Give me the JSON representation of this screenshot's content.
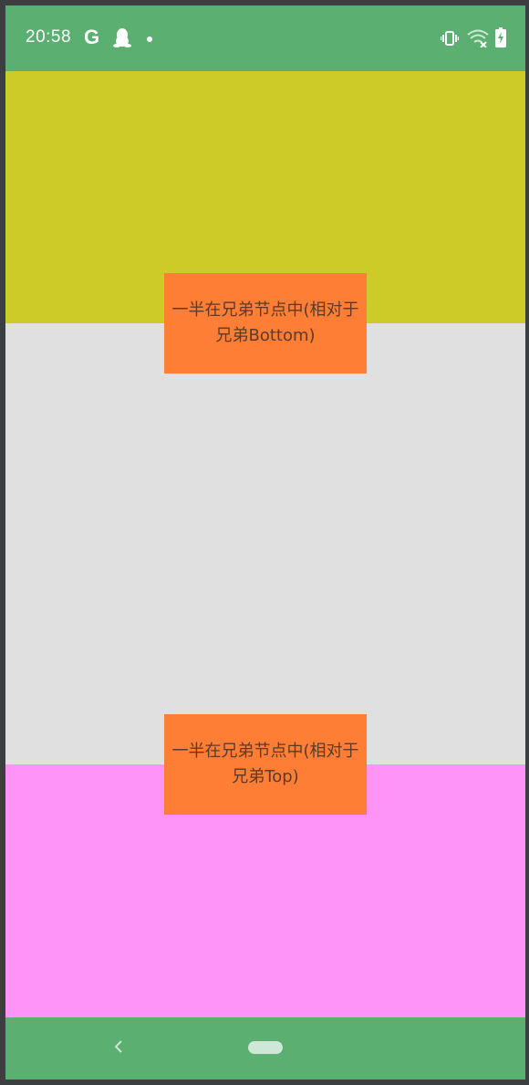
{
  "status_bar": {
    "time": "20:58",
    "icons": [
      "google-g-icon",
      "qq-penguin-icon",
      "notification-dot-icon",
      "vibrate-icon",
      "wifi-off-icon",
      "battery-charging-icon"
    ],
    "g_glyph": "G"
  },
  "colors": {
    "status_bar": "#5baf71",
    "top_block": "#cdcb28",
    "middle_background": "#e0e0e0",
    "bottom_block": "#ff94f7",
    "orange_box": "#fe7e36",
    "nav_bar": "#5baf71"
  },
  "boxes": {
    "top": {
      "line1": "一半在兄弟节点中(相对于",
      "line2": "兄弟Bottom)"
    },
    "bottom": {
      "line1": "一半在兄弟节点中(相对于",
      "line2": "兄弟Top)"
    }
  },
  "nav_bar": {
    "icons": [
      "back-chevron-icon",
      "home-pill-icon"
    ]
  }
}
